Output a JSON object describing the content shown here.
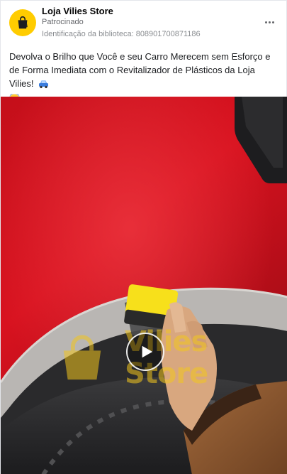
{
  "post": {
    "page_name": "Loja Vilies Store",
    "sponsored_label": "Patrocinado",
    "library_id": "Identificação da biblioteca: 808901700871186",
    "caption": "Devolva o Brilho que Você e seu Carro Merecem sem Esforço e de Forma Imediata com o Revitalizador de Plásticos da Loja Vilies!",
    "caption_emojis": [
      "car-emoji",
      "screaming-face-emoji"
    ],
    "avatar_icon": "shopping-bag-icon",
    "more_icon": "more-options-icon"
  },
  "media": {
    "watermark_line1": "Vilies",
    "watermark_line2": "Store",
    "play_icon": "play-icon"
  },
  "colors": {
    "avatar_bg": "#ffcc00",
    "car_red": "#c8101c",
    "watermark": "#f3c61d",
    "sponge_yellow": "#f7e01b"
  }
}
